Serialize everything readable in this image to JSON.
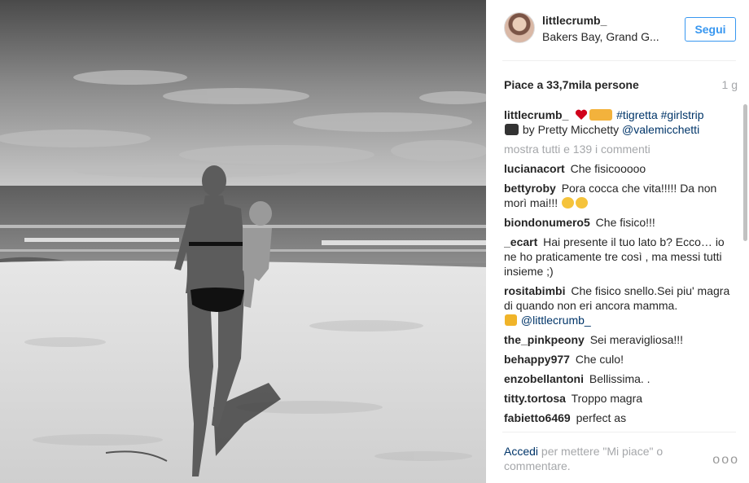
{
  "header": {
    "username": "littlecrumb_",
    "location": "Bakers Bay, Grand G...",
    "follow_label": "Segui"
  },
  "stats": {
    "likes": "Piace a 33,7mila persone",
    "time": "1 g"
  },
  "caption": {
    "username": "littlecrumb_",
    "hashtags": "#tigretta #girlstrip",
    "credit": "by Pretty Micchetty",
    "mention": "@valemicchetti"
  },
  "show_all": "mostra tutti e 139 i commenti",
  "comments": [
    {
      "user": "lucianacort",
      "text": "Che fisicooooo"
    },
    {
      "user": "bettyroby",
      "text": "Pora cocca che vita!!!!! Da non morì mai!!!"
    },
    {
      "user": "biondonumero5",
      "text": "Che fisico!!!"
    },
    {
      "user": "_ecart",
      "text": "Hai presente il tuo lato b? Ecco… io ne ho praticamente tre così , ma messi tutti insieme ;)"
    },
    {
      "user": "rositabimbi",
      "text": "Che fisico snello.Sei piu' magra di quando non eri ancora mamma.",
      "mention": "@littlecrumb_"
    },
    {
      "user": "the_pinkpeony",
      "text": "Sei meravigliosa!!!"
    },
    {
      "user": "behappy977",
      "text": "Che culo!"
    },
    {
      "user": "enzobellantoni",
      "text": "Bellissima. ."
    },
    {
      "user": "titty.tortosa",
      "text": "Troppo magra"
    },
    {
      "user": "fabietto6469",
      "text": "perfect as"
    }
  ],
  "footer": {
    "login_link": "Accedi",
    "login_text": "per mettere \"Mi piace\" o commentare.",
    "more": "ooo"
  },
  "icons": {
    "heart": "heart-emoji-icon",
    "family": "family-emoji-icon",
    "camera": "camera-emoji-icon",
    "laugh": "tears-of-joy-emoji-icon",
    "thumbs": "thumbs-up-emoji-icon"
  },
  "colors": {
    "accent_blue": "#3897f0",
    "link_dark_blue": "#003569",
    "muted_gray": "#a5a7aa"
  }
}
